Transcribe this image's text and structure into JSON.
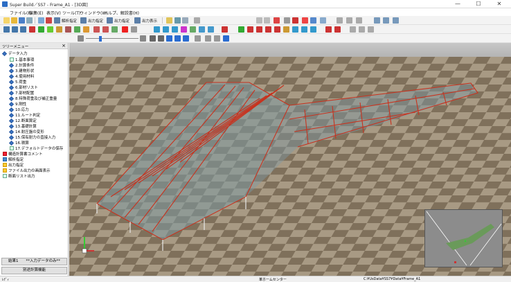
{
  "window": {
    "title": "Super Build／SS7 - Frame_A1 - [3D図]",
    "minimize": "—",
    "maximize": "☐",
    "close": "✕"
  },
  "menu": [
    "ファイル(F)",
    "編集(E)",
    "表示(V)",
    "ツール(T)",
    "ウィンドウ(W)",
    "ヘルプ、解説書(H)"
  ],
  "toolbar": {
    "analysis_label": "解析指定",
    "output_label": "出力指定",
    "output2_label": "出力指定",
    "output_display_label": "出力表示"
  },
  "sidebar": {
    "header": "ツリーメニュー",
    "close_icon": "×",
    "root_label": "データ入力",
    "items": [
      "1.基本事項",
      "2.計算条件",
      "3.建物形状",
      "4.使用材料",
      "5.荷重",
      "6.部材リスト",
      "7.部材配置",
      "8.特殊荷重及び補正重量",
      "9.剛性",
      "10.応力",
      "11.ルート判定",
      "12.断面算定",
      "13.基礎計算",
      "14.耐圧盤の変形",
      "15.保有耐力の直接入力",
      "16.積算",
      "17.デフォルトデータの保存"
    ],
    "other_items": [
      "構造計算書コメント",
      "解析指定",
      "出力指定",
      "ファイル出力の画面表示",
      "断面リスト出力"
    ],
    "footer_buttons": [
      "結果1　　**入力データのみ**",
      "別途計算機能"
    ]
  },
  "statusbar": {
    "left": "ﾚﾃﾞｨ",
    "center": "革ホームセンター",
    "right": "C:¥UsData¥SS7¥Data¥Frame_A1"
  },
  "colors": {
    "floor_light": "#a89a84",
    "floor_dark": "#7f705b",
    "sky_top": "#bfbfbf",
    "beam_red": "#c8321e",
    "column_white": "#e8e8e8",
    "wall_glass": "#7e9aa3"
  }
}
